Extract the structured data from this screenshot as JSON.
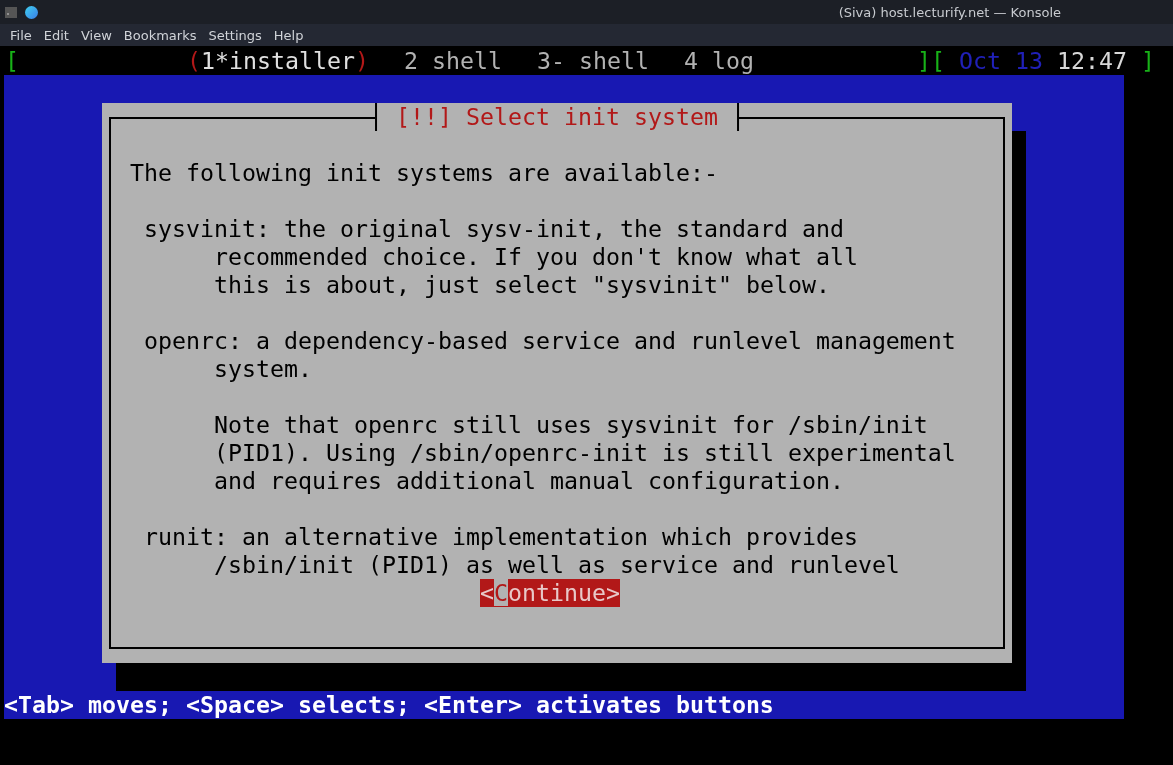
{
  "window": {
    "title": "(Siva) host.lecturify.net — Konsole"
  },
  "menu": [
    "File",
    "Edit",
    "View",
    "Bookmarks",
    "Settings",
    "Help"
  ],
  "screen_tabs": {
    "open_bracket": "[",
    "close_bracket": "]",
    "items": [
      {
        "label": "1*installer",
        "prefix": "(",
        "suffix": ")",
        "selected": true
      },
      {
        "label": "2 shell",
        "selected": false
      },
      {
        "label": "3- shell",
        "selected": false
      },
      {
        "label": "4 log",
        "selected": false
      }
    ],
    "clock_open": "[",
    "date": "Oct 13",
    "time": "12:47",
    "clock_close": "]"
  },
  "dialog": {
    "title": "[!!] Select init system",
    "paragraphs": [
      "The following init systems are available:-",
      " sysvinit: the original sysv-init, the standard and\n      recommended choice. If you don't know what all\n      this is about, just select \"sysvinit\" below.",
      " openrc: a dependency-based service and runlevel management\n      system.",
      "      Note that openrc still uses sysvinit for /sbin/init\n      (PID1). Using /sbin/openrc-init is still experimental\n      and requires additional manual configuration.",
      " runit: an alternative implementation which provides\n      /sbin/init (PID1) as well as service and runlevel"
    ],
    "button": {
      "before": "<",
      "hotkey": "C",
      "after": "ontinue>",
      "focused": true
    }
  },
  "status_line": "<Tab> moves; <Space> selects; <Enter> activates buttons"
}
